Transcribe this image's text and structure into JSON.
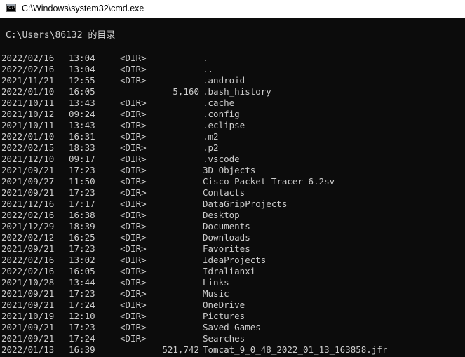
{
  "window": {
    "title": "C:\\Windows\\system32\\cmd.exe",
    "icon": "cmd-icon"
  },
  "console": {
    "heading": "C:\\Users\\86132 的目录",
    "entries": [
      {
        "date": "2022/02/16",
        "time": "13:04",
        "type": "<DIR>",
        "size": "",
        "name": "."
      },
      {
        "date": "2022/02/16",
        "time": "13:04",
        "type": "<DIR>",
        "size": "",
        "name": ".."
      },
      {
        "date": "2021/11/21",
        "time": "12:55",
        "type": "<DIR>",
        "size": "",
        "name": ".android"
      },
      {
        "date": "2022/01/10",
        "time": "16:05",
        "type": "",
        "size": "5,160",
        "name": ".bash_history"
      },
      {
        "date": "2021/10/11",
        "time": "13:43",
        "type": "<DIR>",
        "size": "",
        "name": ".cache"
      },
      {
        "date": "2021/10/12",
        "time": "09:24",
        "type": "<DIR>",
        "size": "",
        "name": ".config"
      },
      {
        "date": "2021/10/11",
        "time": "13:43",
        "type": "<DIR>",
        "size": "",
        "name": ".eclipse"
      },
      {
        "date": "2022/01/10",
        "time": "16:31",
        "type": "<DIR>",
        "size": "",
        "name": ".m2"
      },
      {
        "date": "2022/02/15",
        "time": "18:33",
        "type": "<DIR>",
        "size": "",
        "name": ".p2"
      },
      {
        "date": "2021/12/10",
        "time": "09:17",
        "type": "<DIR>",
        "size": "",
        "name": ".vscode"
      },
      {
        "date": "2021/09/21",
        "time": "17:23",
        "type": "<DIR>",
        "size": "",
        "name": "3D Objects"
      },
      {
        "date": "2021/09/27",
        "time": "11:50",
        "type": "<DIR>",
        "size": "",
        "name": "Cisco Packet Tracer 6.2sv"
      },
      {
        "date": "2021/09/21",
        "time": "17:23",
        "type": "<DIR>",
        "size": "",
        "name": "Contacts"
      },
      {
        "date": "2021/12/16",
        "time": "17:17",
        "type": "<DIR>",
        "size": "",
        "name": "DataGripProjects"
      },
      {
        "date": "2022/02/16",
        "time": "16:38",
        "type": "<DIR>",
        "size": "",
        "name": "Desktop"
      },
      {
        "date": "2021/12/29",
        "time": "18:39",
        "type": "<DIR>",
        "size": "",
        "name": "Documents"
      },
      {
        "date": "2022/02/12",
        "time": "16:25",
        "type": "<DIR>",
        "size": "",
        "name": "Downloads"
      },
      {
        "date": "2021/09/21",
        "time": "17:23",
        "type": "<DIR>",
        "size": "",
        "name": "Favorites"
      },
      {
        "date": "2022/02/16",
        "time": "13:02",
        "type": "<DIR>",
        "size": "",
        "name": "IdeaProjects"
      },
      {
        "date": "2022/02/16",
        "time": "16:05",
        "type": "<DIR>",
        "size": "",
        "name": "Idralianxi"
      },
      {
        "date": "2021/10/28",
        "time": "13:44",
        "type": "<DIR>",
        "size": "",
        "name": "Links"
      },
      {
        "date": "2021/09/21",
        "time": "17:23",
        "type": "<DIR>",
        "size": "",
        "name": "Music"
      },
      {
        "date": "2021/09/21",
        "time": "17:24",
        "type": "<DIR>",
        "size": "",
        "name": "OneDrive"
      },
      {
        "date": "2021/10/19",
        "time": "12:10",
        "type": "<DIR>",
        "size": "",
        "name": "Pictures"
      },
      {
        "date": "2021/09/21",
        "time": "17:23",
        "type": "<DIR>",
        "size": "",
        "name": "Saved Games"
      },
      {
        "date": "2021/09/21",
        "time": "17:24",
        "type": "<DIR>",
        "size": "",
        "name": "Searches"
      },
      {
        "date": "2022/01/13",
        "time": "16:39",
        "type": "",
        "size": "521,742",
        "name": "Tomcat_9_0_48_2022_01_13_163858.jfr"
      }
    ]
  }
}
